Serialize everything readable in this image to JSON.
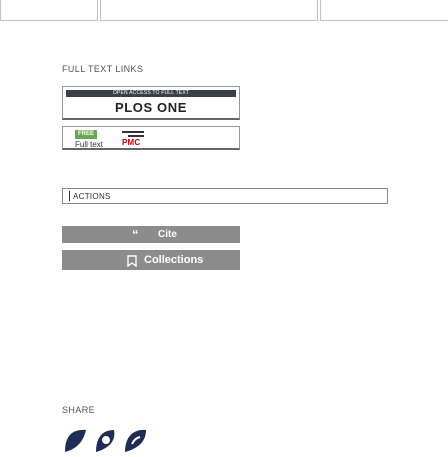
{
  "full_text_links": {
    "heading": "FULL TEXT LINKS",
    "plos": {
      "banner": "OPEN ACCESS TO FULL TEXT",
      "name": "PLOS ONE"
    },
    "pmc": {
      "free_tag": "FREE",
      "full_text_label": "Full text",
      "pmc_label": "PMC"
    }
  },
  "actions": {
    "dropdown_label": "ACTIONS",
    "cite_label": "Cite",
    "cite_icon": "quote-icon",
    "collections_label": "Collections",
    "collections_icon": "bookmark-icon"
  },
  "share": {
    "heading": "SHARE",
    "icons": [
      "twitter-icon",
      "facebook-icon",
      "permalink-icon"
    ]
  },
  "colors": {
    "action_button_bg": "#8c8c8c",
    "free_tag": "#6aa84f",
    "pmc_red": "#cc0000",
    "share_icon": "#1f2d54"
  }
}
